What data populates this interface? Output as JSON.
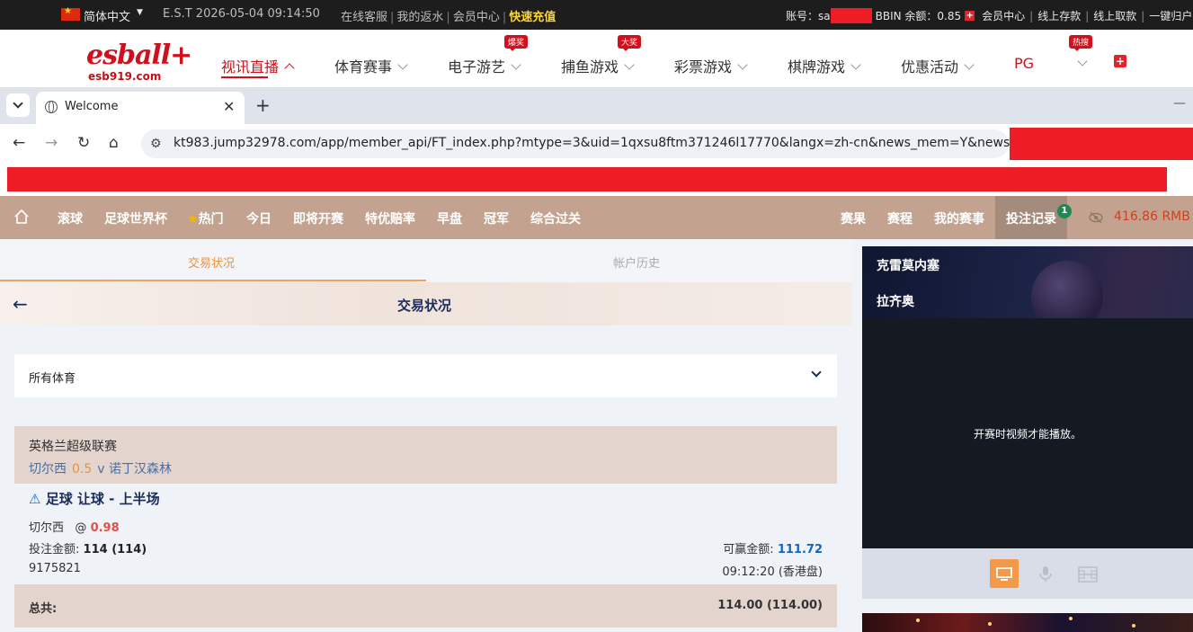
{
  "topbar": {
    "lang": "简体中文",
    "est": "E.S.T 2026-05-04 09:14:50",
    "links": [
      "在线客服",
      "我的返水",
      "会员中心"
    ],
    "quick_deposit": "快速充值",
    "account_label": "账号：",
    "account_prefix": "sa",
    "bbin_label": "BBIN 余额：",
    "bbin_balance": "0.85",
    "right_links": [
      "会员中心",
      "线上存款",
      "线上取款",
      "一键归户"
    ]
  },
  "sitenav": {
    "logo": "esball+",
    "logo_sub": "esb919.com",
    "items": [
      {
        "label": "视讯直播",
        "tag": ""
      },
      {
        "label": "体育赛事",
        "tag": ""
      },
      {
        "label": "电子游艺",
        "tag": "爆奖"
      },
      {
        "label": "捕鱼游戏",
        "tag": "大奖"
      },
      {
        "label": "彩票游戏",
        "tag": ""
      },
      {
        "label": "棋牌游戏",
        "tag": ""
      },
      {
        "label": "优惠活动",
        "tag": ""
      },
      {
        "label": "PG",
        "tag": ""
      },
      {
        "label": "",
        "tag": "热搜"
      }
    ]
  },
  "browser": {
    "tab_title": "Welcome",
    "url": "kt983.jump32978.com/app/member_api/FT_index.php?mtype=3&uid=1qxsu8ftm371246l17770&langx=zh-cn&news_mem=Y&news_a..."
  },
  "appnav": {
    "items": [
      "滚球",
      "足球世界杯",
      "热门",
      "今日",
      "即将开赛",
      "特优赔率",
      "早盘",
      "冠军",
      "综合过关"
    ],
    "right_items": [
      "赛果",
      "赛程",
      "我的赛事",
      "投注记录"
    ],
    "bet_record_badge": "1",
    "balance": "416.86",
    "currency": "RMB"
  },
  "subtabs": [
    "交易状况",
    "帐户历史"
  ],
  "page_title": "交易状况",
  "sport_select": "所有体育",
  "bet": {
    "league": "英格兰超级联赛",
    "home": "切尔西",
    "handicap": "0.5",
    "vs": "v",
    "away": "诺丁汉森林",
    "market": "足球 让球 - 上半场",
    "selection": "切尔西",
    "at": "@",
    "odds": "0.98",
    "stake_label": "投注金额:",
    "stake": "114 (114)",
    "win_label": "可赢金额:",
    "win": "111.72",
    "ticket_id": "9175821",
    "time": "09:12:20 (香港盘)",
    "total_label": "总共:",
    "total": "114.00 (114.00)"
  },
  "video": {
    "team1": "克雷莫内塞",
    "team2": "拉齐奥",
    "message": "开赛时视频才能播放。"
  }
}
